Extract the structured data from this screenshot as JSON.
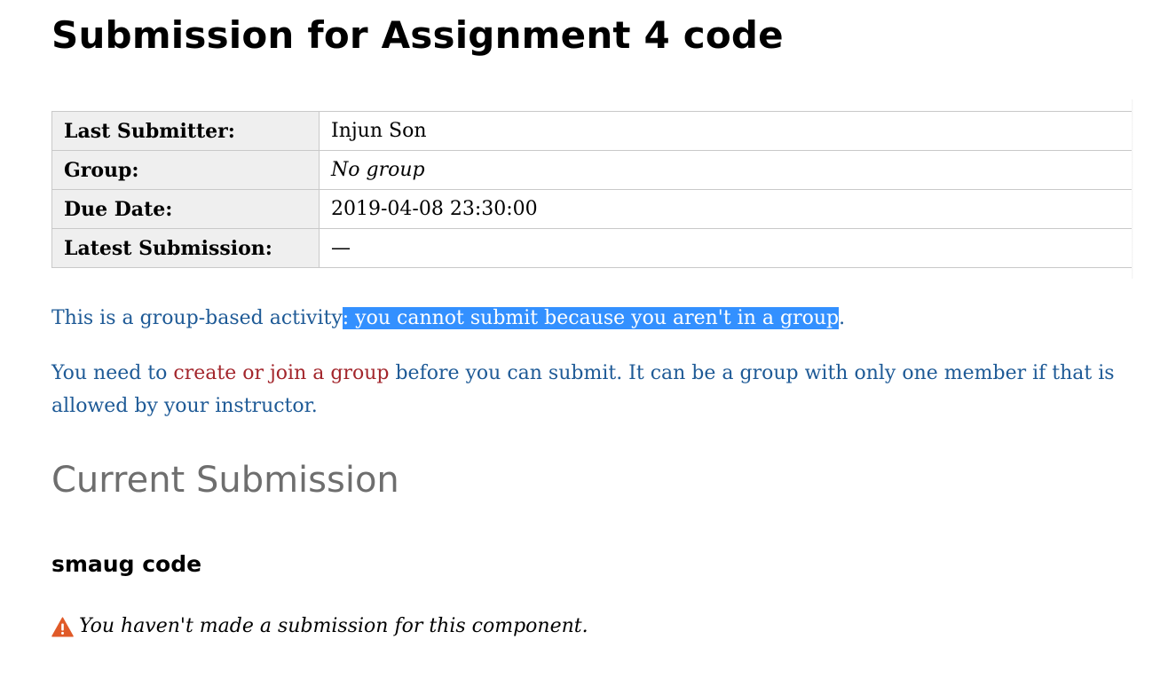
{
  "page": {
    "title": "Submission for Assignment 4 code"
  },
  "info_table": {
    "rows": [
      {
        "label": "Last Submitter:",
        "value": "Injun Son"
      },
      {
        "label": "Group:",
        "value": "No group"
      },
      {
        "label": "Due Date:",
        "value": "2019-04-08 23:30:00"
      },
      {
        "label": "Latest Submission:",
        "value": "—"
      }
    ]
  },
  "group_notice": {
    "prefix": "This is a group-based activity",
    "selected_text": ": you cannot submit because you aren't in a group",
    "suffix": "."
  },
  "group_instructions": {
    "intro": "You need to ",
    "create_link": "create",
    "or_text": " or ",
    "join_link": "join a group",
    "rest": " before you can submit. It can be a group with only one member if that is allowed by your instructor."
  },
  "current_submission": {
    "heading": "Current Submission",
    "component_name": "smaug code",
    "warning_text": "You haven't made a submission for this component.",
    "warning_icon": "warning-triangle-icon"
  },
  "colors": {
    "notice_text": "#1e5a96",
    "link": "#a3262c",
    "selection": "#3390ff",
    "warning_icon": "#e05a28",
    "heading_gray": "#6e6e6e"
  }
}
